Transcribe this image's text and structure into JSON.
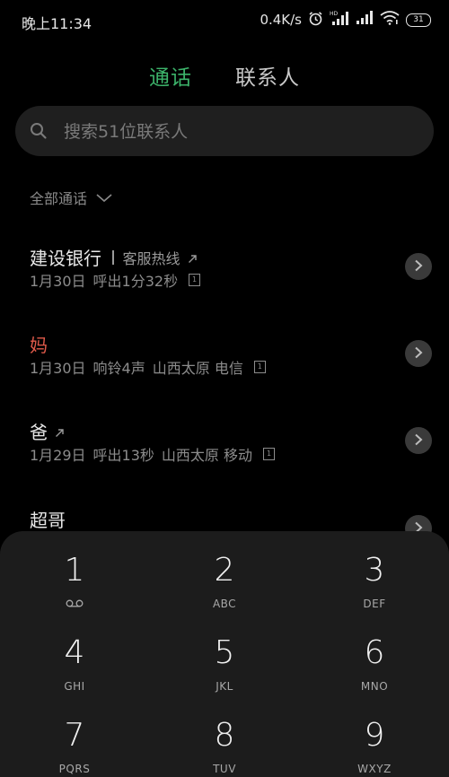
{
  "status_bar": {
    "time": "晚上11:34",
    "net_speed": "0.4K/s",
    "hd_label": "HD",
    "battery": "31",
    "icons": [
      "alarm-icon",
      "signal-hd-icon",
      "signal-icon",
      "wifi-icon",
      "battery-icon"
    ]
  },
  "tabs": [
    {
      "label": "通话",
      "active": true,
      "color": "#3cb36a"
    },
    {
      "label": "联系人",
      "active": false
    }
  ],
  "search": {
    "placeholder": "搜索51位联系人",
    "value": ""
  },
  "filter": {
    "label": "全部通话"
  },
  "calls": [
    {
      "name": "建设银行",
      "tag": "客服热线",
      "outgoing": true,
      "missed": false,
      "date": "1月30日",
      "detail": "呼出1分32秒",
      "location": "",
      "sim": "1"
    },
    {
      "name": "妈",
      "tag": "",
      "outgoing": false,
      "missed": true,
      "date": "1月30日",
      "detail": "响铃4声",
      "location": "山西太原 电信",
      "sim": "1"
    },
    {
      "name": "爸",
      "tag": "",
      "outgoing": true,
      "missed": false,
      "date": "1月29日",
      "detail": "呼出13秒",
      "location": "山西太原 移动",
      "sim": "1"
    },
    {
      "name": "超哥",
      "tag": "",
      "outgoing": false,
      "missed": false,
      "date": "",
      "detail": "",
      "location": "",
      "sim": ""
    }
  ],
  "dialpad": {
    "keys": [
      {
        "digit": "1",
        "sub": "",
        "sub_icon": "voicemail-icon"
      },
      {
        "digit": "2",
        "sub": "ABC"
      },
      {
        "digit": "3",
        "sub": "DEF"
      },
      {
        "digit": "4",
        "sub": "GHI"
      },
      {
        "digit": "5",
        "sub": "JKL"
      },
      {
        "digit": "6",
        "sub": "MNO"
      },
      {
        "digit": "7",
        "sub": "PQRS"
      },
      {
        "digit": "8",
        "sub": "TUV"
      },
      {
        "digit": "9",
        "sub": "WXYZ"
      }
    ]
  },
  "colors": {
    "accent": "#3cb36a",
    "missed": "#e05a4a",
    "background": "#000000"
  }
}
